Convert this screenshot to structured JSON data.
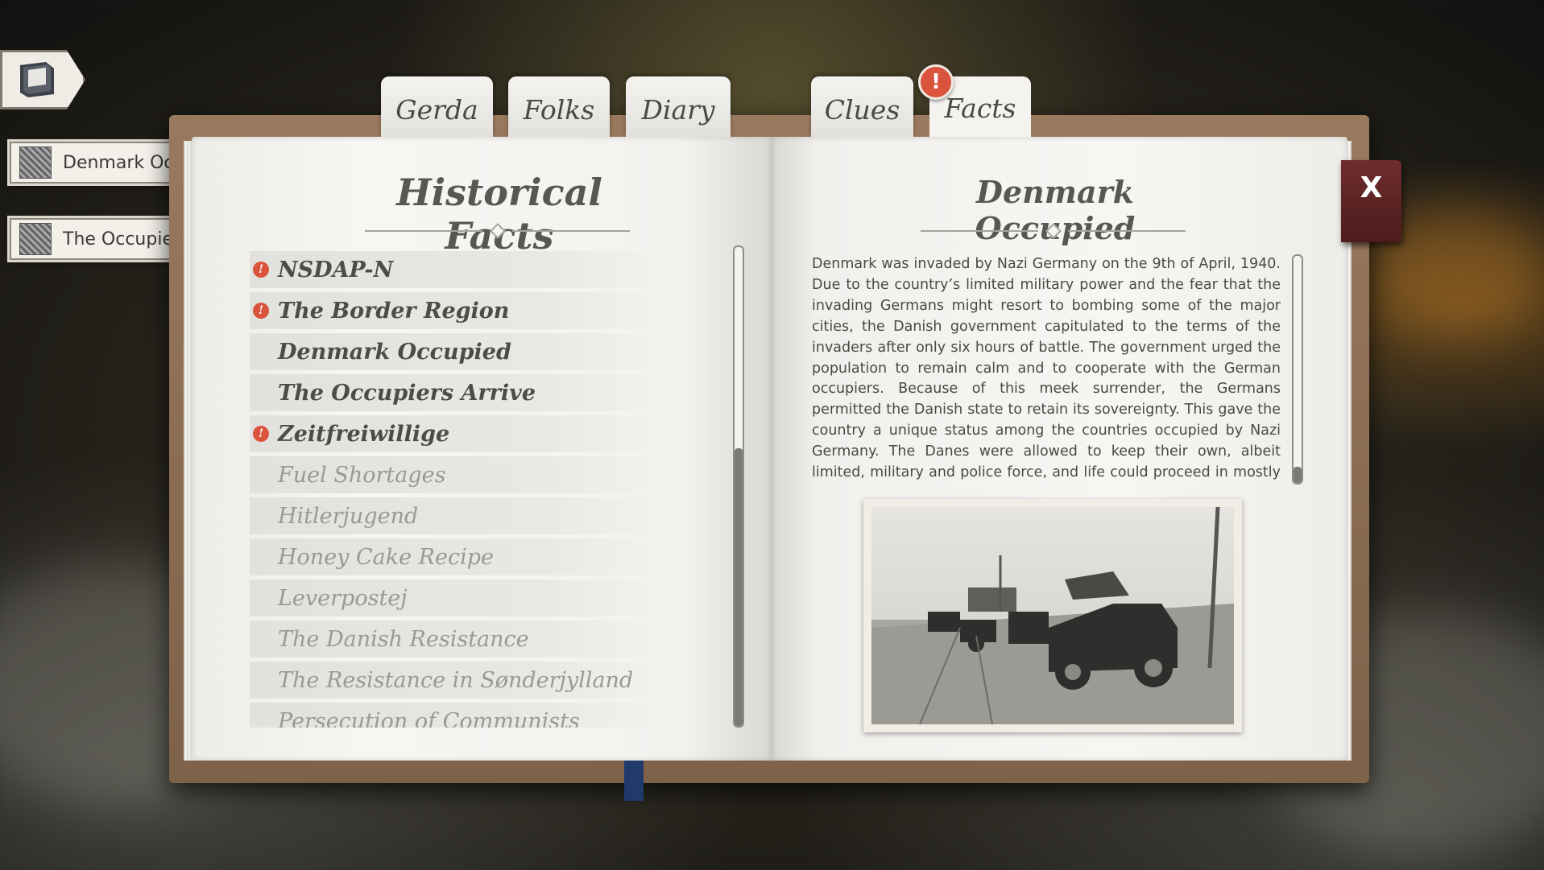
{
  "tabs": [
    {
      "label": "Gerda"
    },
    {
      "label": "Folks"
    },
    {
      "label": "Diary"
    },
    {
      "label": "Clues"
    },
    {
      "label": "Facts",
      "active": true,
      "alert": "!"
    }
  ],
  "quick_links": [
    {
      "label": "Denmark Occupied"
    },
    {
      "label": "The Occupiers Arrive"
    }
  ],
  "left_page": {
    "title": "Historical Facts",
    "facts": [
      {
        "label": "NSDAP-N",
        "state": "read",
        "alert": "!"
      },
      {
        "label": "The Border Region",
        "state": "read",
        "alert": "!"
      },
      {
        "label": "Denmark Occupied",
        "state": "read",
        "alert": ""
      },
      {
        "label": "The Occupiers Arrive",
        "state": "read",
        "alert": ""
      },
      {
        "label": "Zeitfreiwillige",
        "state": "read",
        "alert": "!"
      },
      {
        "label": "Fuel Shortages",
        "state": "locked",
        "alert": ""
      },
      {
        "label": "Hitlerjugend",
        "state": "locked",
        "alert": ""
      },
      {
        "label": "Honey Cake Recipe",
        "state": "locked",
        "alert": ""
      },
      {
        "label": "Leverpostej",
        "state": "locked",
        "alert": ""
      },
      {
        "label": "The Danish Resistance",
        "state": "locked",
        "alert": ""
      },
      {
        "label": "The Resistance in Sønderjylland",
        "state": "locked",
        "alert": ""
      },
      {
        "label": "Persecution of Communists",
        "state": "locked",
        "alert": ""
      }
    ]
  },
  "right_page": {
    "title": "Denmark Occupied",
    "body": "Denmark was invaded by Nazi Germany on the 9th of April, 1940. Due to the country’s limited military power and the fear that the invading Germans might resort to bombing some of the major cities, the Danish government capitulated to the terms of the invaders after only six hours of battle. The government urged the population to remain calm and to cooperate with the German occupiers. Because of this meek surrender, the Germans permitted the Danish state to retain its sovereignty. This gave the country a unique status among the countries occupied by Nazi Germany. The Danes were allowed to keep their own, albeit limited, military and police force, and life could proceed in mostly the same manner as it had always done."
  },
  "close_button": {
    "label": "X"
  },
  "alert_color": "#d9533d",
  "close_color": "#5e2424"
}
